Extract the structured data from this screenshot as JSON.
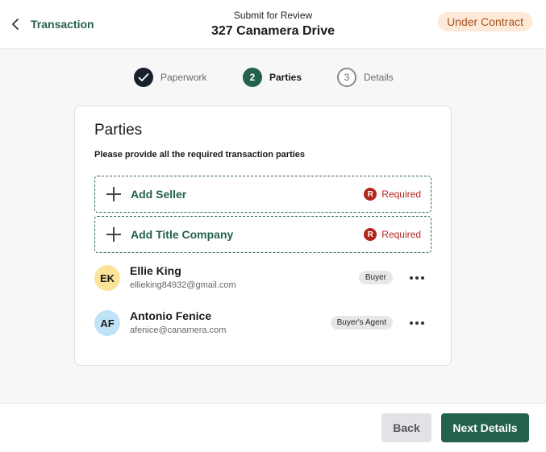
{
  "header": {
    "back_label": "Transaction",
    "subtitle": "Submit for Review",
    "title": "327 Canamera Drive",
    "status": "Under Contract"
  },
  "stepper": {
    "steps": [
      {
        "number": "",
        "label": "Paperwork",
        "state": "complete"
      },
      {
        "number": "2",
        "label": "Parties",
        "state": "current"
      },
      {
        "number": "3",
        "label": "Details",
        "state": "upcoming"
      }
    ]
  },
  "card": {
    "title": "Parties",
    "subtitle": "Please provide all the required transaction parties",
    "add_rows": [
      {
        "label": "Add Seller",
        "required_icon": "R",
        "required_label": "Required"
      },
      {
        "label": "Add Title Company",
        "required_icon": "R",
        "required_label": "Required"
      }
    ],
    "parties": [
      {
        "initials": "EK",
        "name": "Ellie King",
        "email": "ellieking84932@gmail.com",
        "role": "Buyer"
      },
      {
        "initials": "AF",
        "name": "Antonio Fenice",
        "email": "afenice@canamera.com",
        "role": "Buyer's Agent"
      }
    ]
  },
  "footer": {
    "back_label": "Back",
    "next_label": "Next Details"
  },
  "colors": {
    "brand_green": "#23614a",
    "required_red": "#b3261e",
    "status_bg": "#fde9d6",
    "status_text": "#a5511f",
    "step_complete": "#17202b"
  },
  "icons": {
    "back": "chevron-left-icon",
    "complete_step": "check-icon",
    "add": "plus-icon",
    "required": "required-icon",
    "more": "more-horizontal-icon"
  }
}
